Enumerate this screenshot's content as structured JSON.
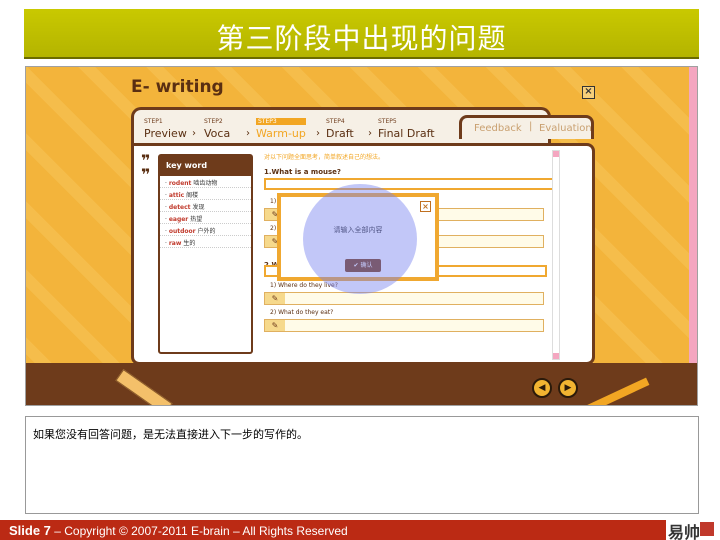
{
  "slide": {
    "title": "第三阶段中出现的问题",
    "note": "如果您没有回答问题，是无法直接进入下一步的写作的。",
    "footer_number": "Slide 7",
    "footer_copyright": " – Copyright © 2007-2011 E-brain – All Rights Reserved",
    "logo_glyph": "易帅"
  },
  "app": {
    "logo": "E- writing",
    "close_label": "×",
    "steps": [
      {
        "num": "STEP1",
        "name": "Preview"
      },
      {
        "num": "STEP2",
        "name": "Voca"
      },
      {
        "num": "STEP3",
        "name": "Warm-up"
      },
      {
        "num": "STEP4",
        "name": "Draft"
      },
      {
        "num": "STEP5",
        "name": "Final Draft"
      }
    ],
    "tabs": {
      "feedback": "Feedback",
      "separator": "|",
      "evaluation": "Evaluation"
    },
    "keyword_header": "key word",
    "keywords": [
      {
        "en": "rodent",
        "zh": "啮齿动物"
      },
      {
        "en": "attic",
        "zh": "阁楼"
      },
      {
        "en": "detect",
        "zh": "发现"
      },
      {
        "en": "eager",
        "zh": "热望"
      },
      {
        "en": "outdoor",
        "zh": "户外的"
      },
      {
        "en": "raw",
        "zh": "生的"
      }
    ],
    "instruction": "对以下问题全面思考，简单叙述自己的想法。",
    "q1_title": "1.What is a mouse?",
    "q2_title": "2.W",
    "sub1_prefix": "1)",
    "sub2_prefix": "2)",
    "sub_where": "1) Where do they live?",
    "sub_eat": "2) What do they eat?",
    "pen_icon": "✎",
    "modal": {
      "message": "请输入全部内容",
      "confirm": "✔ 确认",
      "close": "×"
    },
    "nav": {
      "prev": "◀",
      "next": "▶"
    }
  }
}
